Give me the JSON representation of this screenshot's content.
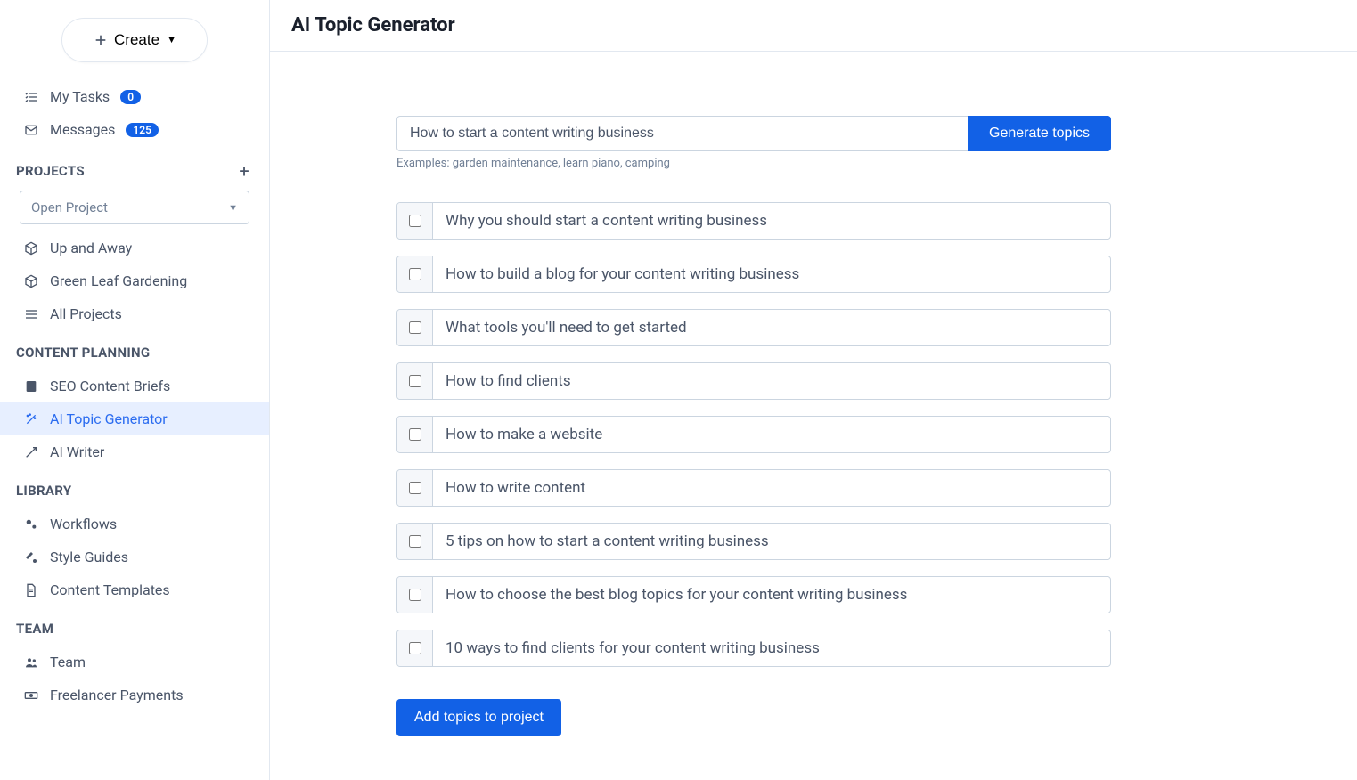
{
  "sidebar": {
    "create_label": "Create",
    "nav": {
      "my_tasks": {
        "label": "My Tasks",
        "badge": "0"
      },
      "messages": {
        "label": "Messages",
        "badge": "125"
      }
    },
    "projects": {
      "header": "PROJECTS",
      "select_placeholder": "Open Project",
      "items": [
        {
          "label": "Up and Away"
        },
        {
          "label": "Green Leaf Gardening"
        },
        {
          "label": "All Projects"
        }
      ]
    },
    "content_planning": {
      "header": "CONTENT PLANNING",
      "items": [
        {
          "label": "SEO Content Briefs"
        },
        {
          "label": "AI Topic Generator"
        },
        {
          "label": "AI Writer"
        }
      ]
    },
    "library": {
      "header": "LIBRARY",
      "items": [
        {
          "label": "Workflows"
        },
        {
          "label": "Style Guides"
        },
        {
          "label": "Content Templates"
        }
      ]
    },
    "team": {
      "header": "TEAM",
      "items": [
        {
          "label": "Team"
        },
        {
          "label": "Freelancer Payments"
        }
      ]
    }
  },
  "main": {
    "title": "AI Topic Generator",
    "input_value": "How to start a content writing business",
    "generate_label": "Generate topics",
    "examples": "Examples: garden maintenance, learn piano, camping",
    "topics": [
      "Why you should start a content writing business",
      "How to build a blog for your content writing business",
      "What tools you'll need to get started",
      "How to find clients",
      "How to make a website",
      "How to write content",
      "5 tips on how to start a content writing business",
      "How to choose the best blog topics for your content writing business",
      "10 ways to find clients for your content writing business"
    ],
    "add_label": "Add topics to project"
  }
}
